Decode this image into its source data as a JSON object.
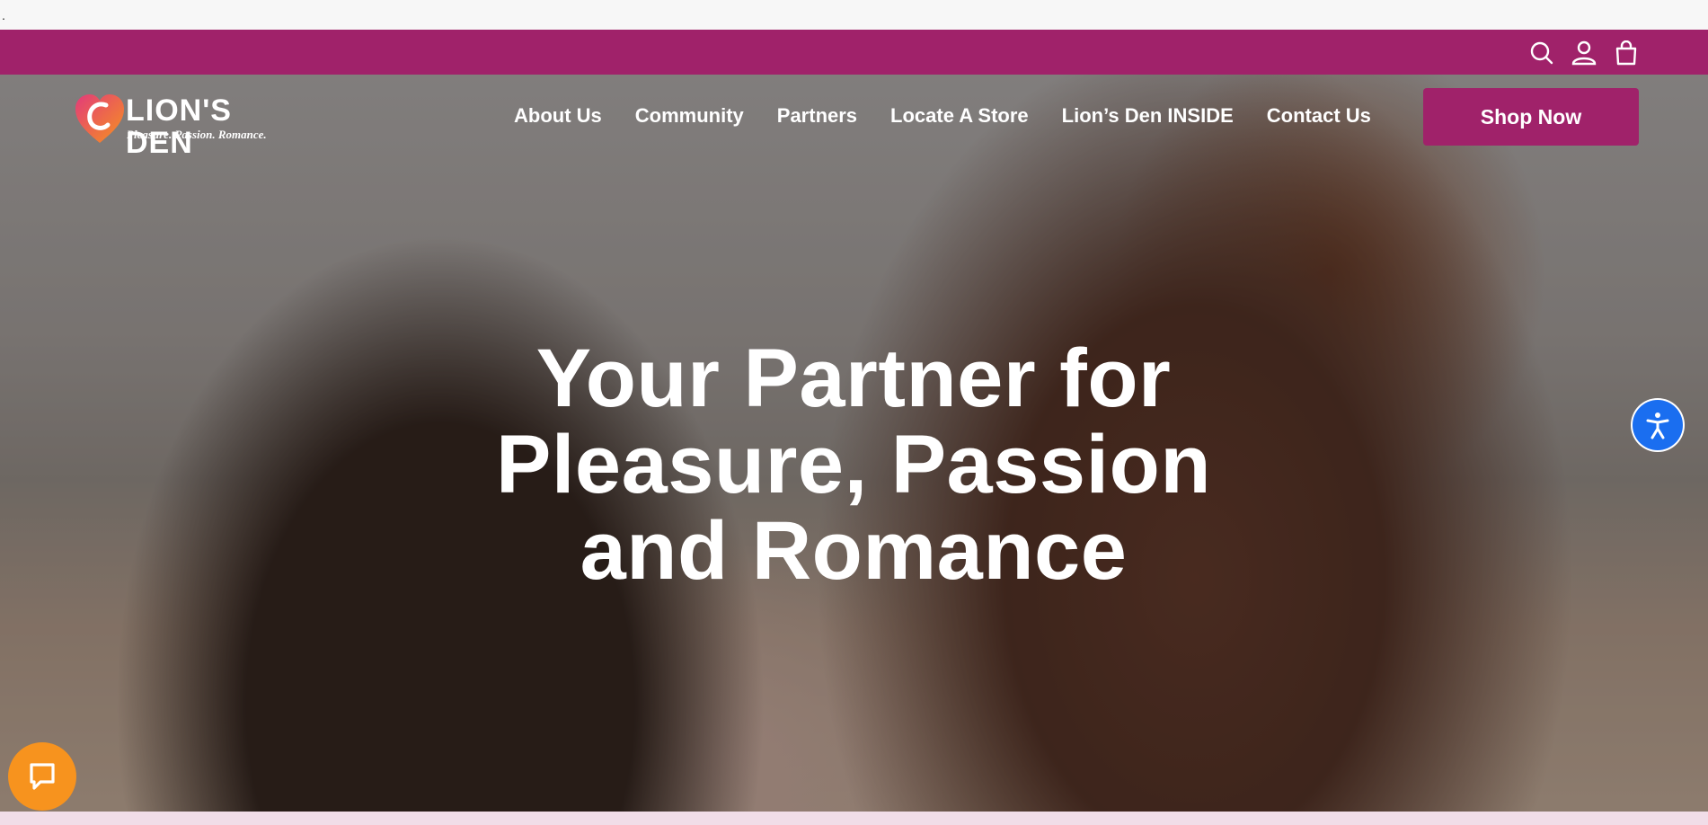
{
  "page": {
    "stray_text": "."
  },
  "utility_bar": {
    "icons": [
      "search-icon",
      "account-icon",
      "shopping-bag-icon"
    ],
    "background": "#a0226a"
  },
  "header": {
    "logo": {
      "name": "LION'S DEN",
      "tagline": "Pleasure. Passion. Romance."
    },
    "nav": [
      {
        "label": "About Us"
      },
      {
        "label": "Community"
      },
      {
        "label": "Partners"
      },
      {
        "label": "Locate A Store"
      },
      {
        "label": "Lion’s Den INSIDE"
      },
      {
        "label": "Contact Us"
      }
    ],
    "cta_label": "Shop Now"
  },
  "hero": {
    "title_lines": [
      "Your Partner for",
      "Pleasure, Passion",
      "and Romance"
    ]
  },
  "widgets": {
    "accessibility_icon": "accessibility-icon",
    "chat_icon": "chat-bubble-icon",
    "accessibility_color": "#1a6ef0",
    "chat_color": "#f7931e"
  },
  "colors": {
    "brand": "#a0226a",
    "bottom_strip": "#f1dde8"
  }
}
